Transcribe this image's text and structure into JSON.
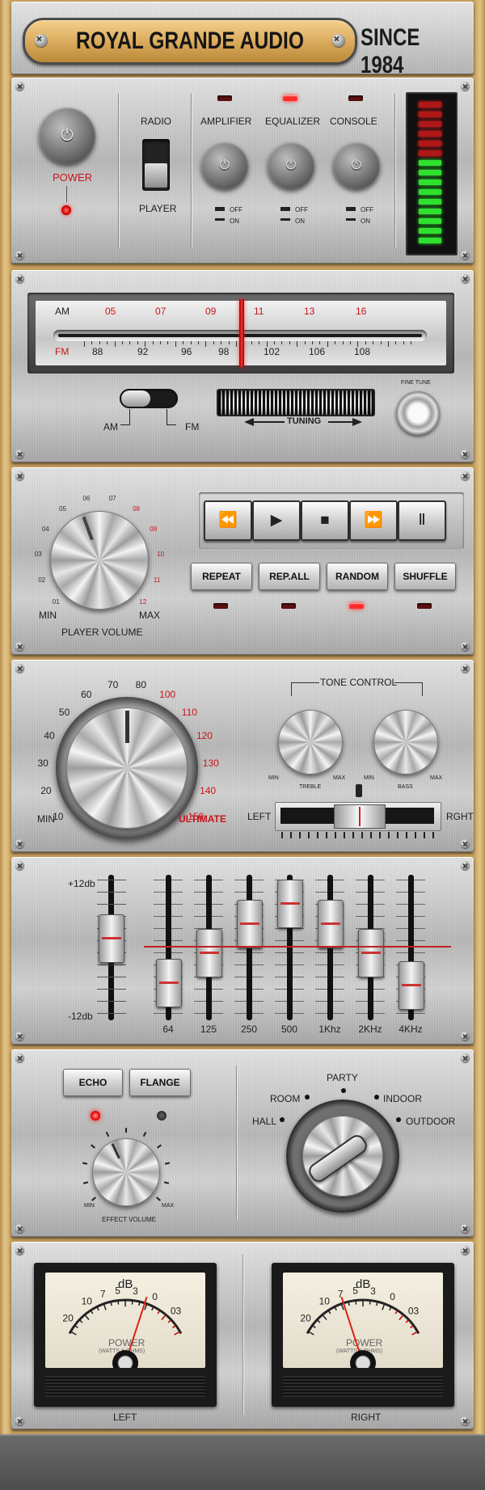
{
  "header": {
    "brand": "ROYAL GRANDE AUDIO",
    "since": "SINCE 1984"
  },
  "power_panel": {
    "power_label": "POWER",
    "selector": {
      "top": "RADIO",
      "bottom": "PLAYER"
    },
    "channels": [
      {
        "label": "AMPLIFIER",
        "led_on": false,
        "off": "OFF",
        "on": "ON"
      },
      {
        "label": "EQUALIZER",
        "led_on": true,
        "off": "OFF",
        "on": "ON"
      },
      {
        "label": "CONSOLE",
        "led_on": false,
        "off": "OFF",
        "on": "ON"
      }
    ],
    "level_meter": {
      "red_segments": 6,
      "green_segments": 9
    }
  },
  "tuner": {
    "am_label": "AM",
    "fm_label": "FM",
    "am_scale": [
      "05",
      "07",
      "09",
      "11",
      "13",
      "16"
    ],
    "fm_scale": [
      "88",
      "92",
      "96",
      "98",
      "102",
      "106",
      "108"
    ],
    "band_am": "AM",
    "band_fm": "FM",
    "tuning": "TUNING",
    "fine_tune": "FINE TUNE"
  },
  "player": {
    "volume_label": "PLAYER VOLUME",
    "min": "MIN",
    "max": "MAX",
    "scale": [
      "01",
      "02",
      "03",
      "04",
      "05",
      "06",
      "07",
      "08",
      "09",
      "10",
      "11",
      "12"
    ],
    "transport": {
      "rewind": "⏪",
      "play": "▶",
      "stop": "■",
      "forward": "⏩",
      "pause": "Ⅱ"
    },
    "modes": [
      {
        "label": "REPEAT",
        "led_on": false
      },
      {
        "label": "REP.ALL",
        "led_on": false
      },
      {
        "label": "RANDOM",
        "led_on": true
      },
      {
        "label": "SHUFFLE",
        "led_on": false
      }
    ]
  },
  "master": {
    "scale_black": [
      "10",
      "20",
      "30",
      "40",
      "50",
      "60",
      "70",
      "80"
    ],
    "scale_red": [
      "100",
      "110",
      "120",
      "130",
      "140",
      "150"
    ],
    "min": "MIN",
    "ultimate": "ULTIMATE",
    "tone_control": "TONE CONTROL",
    "treble": {
      "label": "TREBLE",
      "min": "MIN",
      "max": "MAX"
    },
    "bass": {
      "label": "BASS",
      "min": "MIN",
      "max": "MAX"
    },
    "balance": {
      "left": "LEFT",
      "right": "RGHT"
    }
  },
  "equalizer": {
    "top_label": "+12db",
    "bottom_label": "-12db",
    "bands": [
      {
        "label": "64",
        "level": 0.15
      },
      {
        "label": "125",
        "level": 0.45
      },
      {
        "label": "250",
        "level": 0.75
      },
      {
        "label": "500",
        "level": 0.95
      },
      {
        "label": "1Khz",
        "level": 0.75
      },
      {
        "label": "2KHz",
        "level": 0.45
      },
      {
        "label": "4KHz",
        "level": 0.12
      }
    ],
    "master_level": 0.6
  },
  "effects": {
    "echo": "ECHO",
    "flange": "FLANGE",
    "volume_label": "EFFECT VOLUME",
    "min": "MIN",
    "max": "MAX",
    "modes": [
      "HALL",
      "ROOM",
      "PARTY",
      "INDOOR",
      "OUTDOOR"
    ]
  },
  "meters": [
    {
      "channel": "LEFT",
      "db": "dB",
      "scale": [
        "20",
        "10",
        "7",
        "5",
        "3",
        "0",
        "03"
      ],
      "power": "POWER",
      "sub": "(WATTS 8 OHMS)"
    },
    {
      "channel": "RIGHT",
      "db": "dB",
      "scale": [
        "20",
        "10",
        "7",
        "5",
        "3",
        "0",
        "03"
      ],
      "power": "POWER",
      "sub": "(WATTS 8 OHMS)"
    }
  ],
  "colors": {
    "accent_red": "#c8141a",
    "led_red": "#ff2a2a",
    "meter_green": "#2fe02f",
    "wood": "#c9a467"
  }
}
